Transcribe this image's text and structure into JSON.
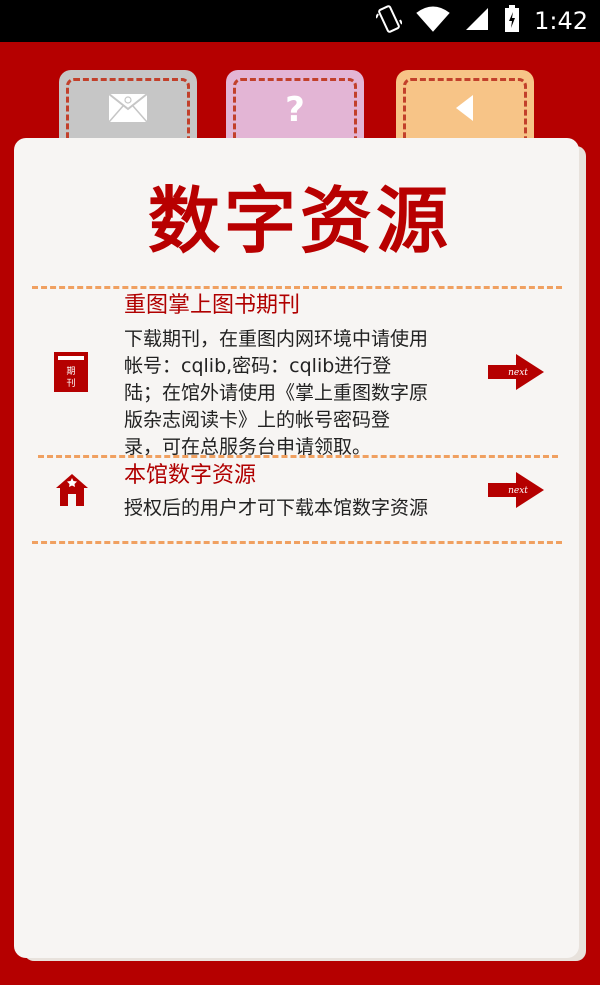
{
  "status_bar": {
    "time": "1:42"
  },
  "tabs": [
    {
      "name": "mail",
      "icon": "mail-icon"
    },
    {
      "name": "help",
      "icon": "question-icon",
      "glyph": "?"
    },
    {
      "name": "back",
      "icon": "back-arrow-icon"
    }
  ],
  "page": {
    "title": "数字资源"
  },
  "items": [
    {
      "title": "重图掌上图书期刊",
      "icon": "periodical-icon",
      "icon_text": [
        "期",
        "刊"
      ],
      "description": [
        "下载期刊，在重图内网环境中请使用",
        "帐号：cqlib,密码：cqlib进行登",
        "陆；在馆外请使用《掌上重图数字原",
        "版杂志阅读卡》上的帐号密码登",
        "录，可在总服务台申请领取。"
      ],
      "next_label": "next"
    },
    {
      "title": "本馆数字资源",
      "icon": "library-home-icon",
      "description": [
        "授权后的用户才可下载本馆数字资源"
      ],
      "next_label": "next"
    }
  ],
  "colors": {
    "frame": "#b50000",
    "accent": "#b80000",
    "dash": "#f0a060",
    "paper": "#f7f5f3"
  }
}
